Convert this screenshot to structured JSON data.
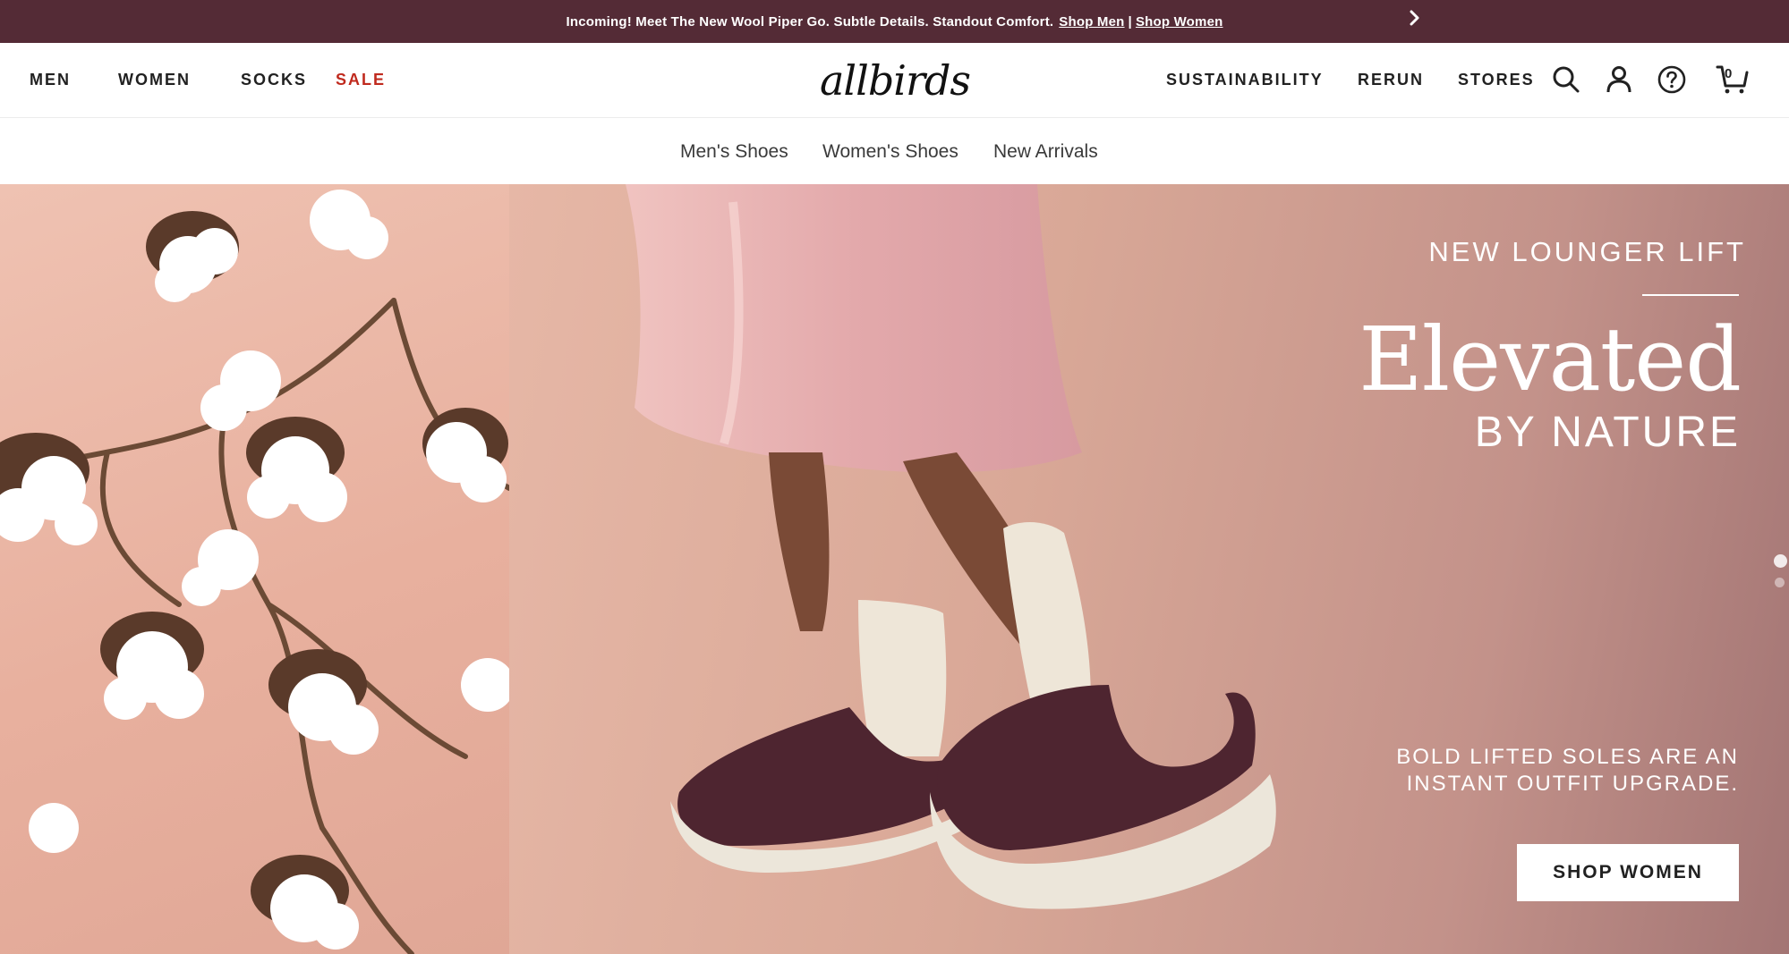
{
  "announcement": {
    "message": "Incoming! Meet The New Wool Piper Go. Subtle Details. Standout Comfort.",
    "link_men": "Shop Men",
    "separator": "|",
    "link_women": "Shop Women",
    "next_icon": "chevron-right-icon"
  },
  "nav": {
    "left": [
      {
        "label": "MEN"
      },
      {
        "label": "WOMEN"
      },
      {
        "label": "SOCKS"
      },
      {
        "label": "SALE"
      }
    ],
    "logo": "allbirds",
    "right": [
      {
        "label": "SUSTAINABILITY"
      },
      {
        "label": "RERUN"
      },
      {
        "label": "STORES"
      }
    ],
    "icons": [
      "search-icon",
      "account-icon",
      "help-icon",
      "cart-icon"
    ],
    "cart_count": "0"
  },
  "subnav": {
    "items": [
      {
        "label": "Men's Shoes"
      },
      {
        "label": "Women's Shoes"
      },
      {
        "label": "New Arrivals"
      }
    ]
  },
  "hero": {
    "eyebrow": "NEW LOUNGER LIFT",
    "headline": "Elevated",
    "subhead": "BY NATURE",
    "body": "BOLD LIFTED SOLES ARE AN INSTANT OUTFIT UPGRADE.",
    "cta": "SHOP WOMEN",
    "slide_count": 2,
    "active_slide": 1
  },
  "colors": {
    "announcement_bg": "#542b36",
    "sale": "#c02a1e",
    "hero_pink": "#e6b7a6",
    "shoe_burgundy": "#4e2530"
  }
}
